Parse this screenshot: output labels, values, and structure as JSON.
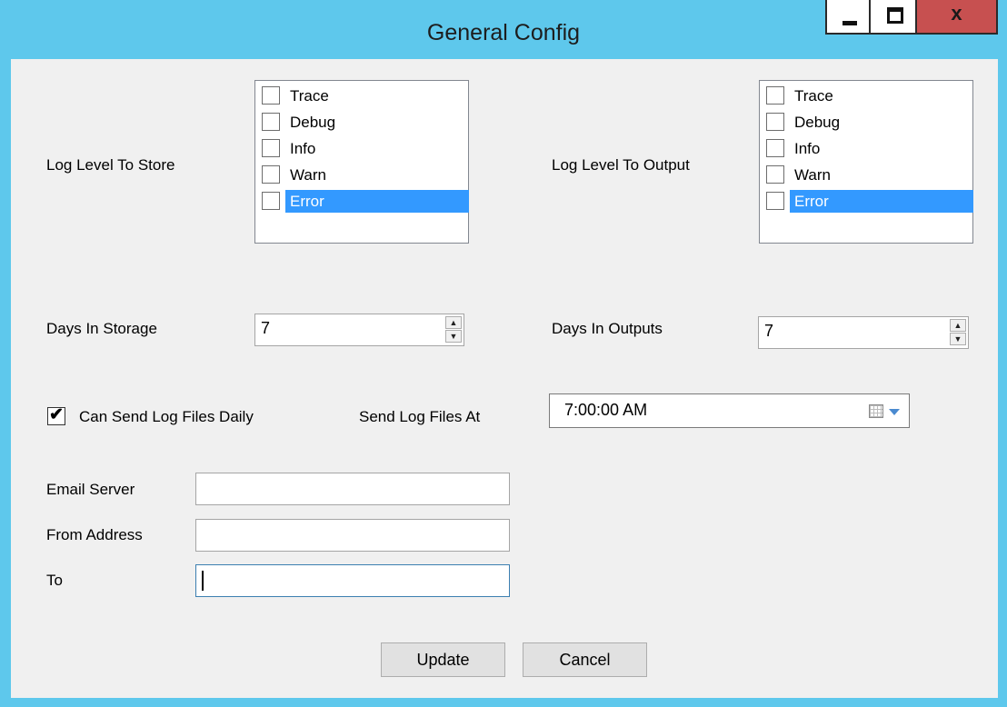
{
  "window": {
    "title": "General Config",
    "controls": {
      "minimize": "minimize",
      "maximize": "maximize",
      "close": "x"
    }
  },
  "store_section": {
    "label": "Log Level To Store",
    "items": [
      {
        "label": "Trace",
        "checked": false,
        "selected": false
      },
      {
        "label": "Debug",
        "checked": false,
        "selected": false
      },
      {
        "label": "Info",
        "checked": false,
        "selected": false
      },
      {
        "label": "Warn",
        "checked": false,
        "selected": false
      },
      {
        "label": "Error",
        "checked": false,
        "selected": true
      }
    ]
  },
  "output_section": {
    "label": "Log Level To Output",
    "items": [
      {
        "label": "Trace",
        "checked": false,
        "selected": false
      },
      {
        "label": "Debug",
        "checked": false,
        "selected": false
      },
      {
        "label": "Info",
        "checked": false,
        "selected": false
      },
      {
        "label": "Warn",
        "checked": false,
        "selected": false
      },
      {
        "label": "Error",
        "checked": false,
        "selected": true
      }
    ]
  },
  "days_storage": {
    "label": "Days In Storage",
    "value": "7"
  },
  "days_outputs": {
    "label": "Days In Outputs",
    "value": "7"
  },
  "send_daily": {
    "label": "Can Send Log Files Daily",
    "checked": true,
    "check_glyph": "✔"
  },
  "send_at": {
    "label": "Send Log Files At",
    "value": "7:00:00 AM"
  },
  "email": {
    "server_label": "Email Server",
    "server_value": "",
    "from_label": "From Address",
    "from_value": "",
    "to_label": "To",
    "to_value": ""
  },
  "buttons": {
    "update": "Update",
    "cancel": "Cancel"
  },
  "colors": {
    "title_bar": "#5ec8ec",
    "close_button": "#c75050",
    "selection": "#3399ff",
    "client_bg": "#f0f0f0"
  }
}
